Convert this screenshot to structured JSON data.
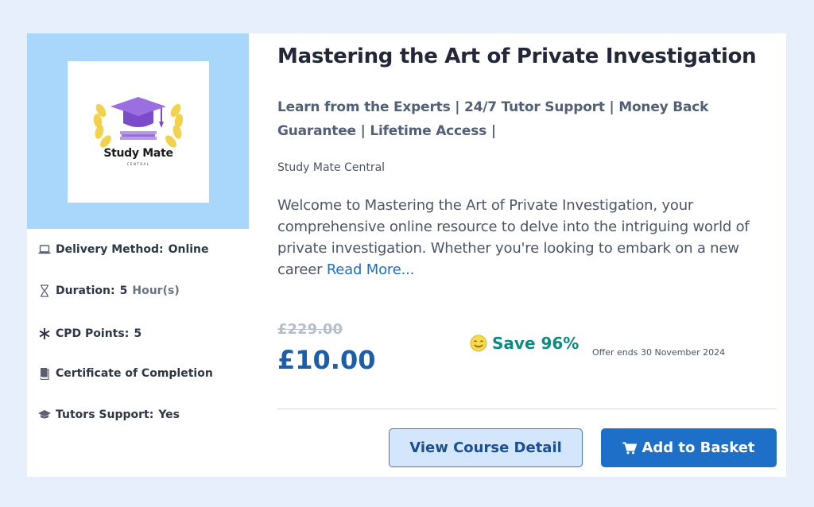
{
  "course": {
    "title": "Mastering the Art of Private Investigation",
    "tagline": "Learn from the Experts | 24/7 Tutor Support | Money Back Guarantee | Lifetime Access |",
    "provider": "Study Mate Central",
    "description": "Welcome to Mastering the Art of Private Investigation, your comprehensive online resource to delve into the intriguing world of private investigation. Whether you're looking to embark on a new career",
    "read_more": "Read More..."
  },
  "logo": {
    "title": "Study Mate",
    "subtitle": "CENTRAL"
  },
  "meta": {
    "delivery": {
      "label": "Delivery Method:",
      "value": "Online",
      "icon": "laptop-icon"
    },
    "duration": {
      "label": "Duration:",
      "value": "5",
      "unit": "Hour(s)",
      "icon": "hourglass-icon"
    },
    "cpd": {
      "label": "CPD Points:",
      "value": "5",
      "icon": "asterisk-icon"
    },
    "certificate": {
      "label": "Certificate of Completion",
      "icon": "certificate-icon"
    },
    "tutors": {
      "label": "Tutors Support:",
      "value": "Yes",
      "icon": "graduation-cap-icon"
    }
  },
  "pricing": {
    "old_price": "£229.00",
    "price": "£10.00",
    "save": "Save 96%",
    "offer": "Offer ends 30 November 2024"
  },
  "buttons": {
    "view_detail": "View Course Detail",
    "add_to_basket": "Add to Basket"
  },
  "colors": {
    "page_bg": "#e6effb",
    "image_panel": "#a9d6fb",
    "price": "#1d5ea8",
    "save": "#0f8a82",
    "primary_button": "#1d6fc8",
    "secondary_button": "#d4e6fb"
  }
}
